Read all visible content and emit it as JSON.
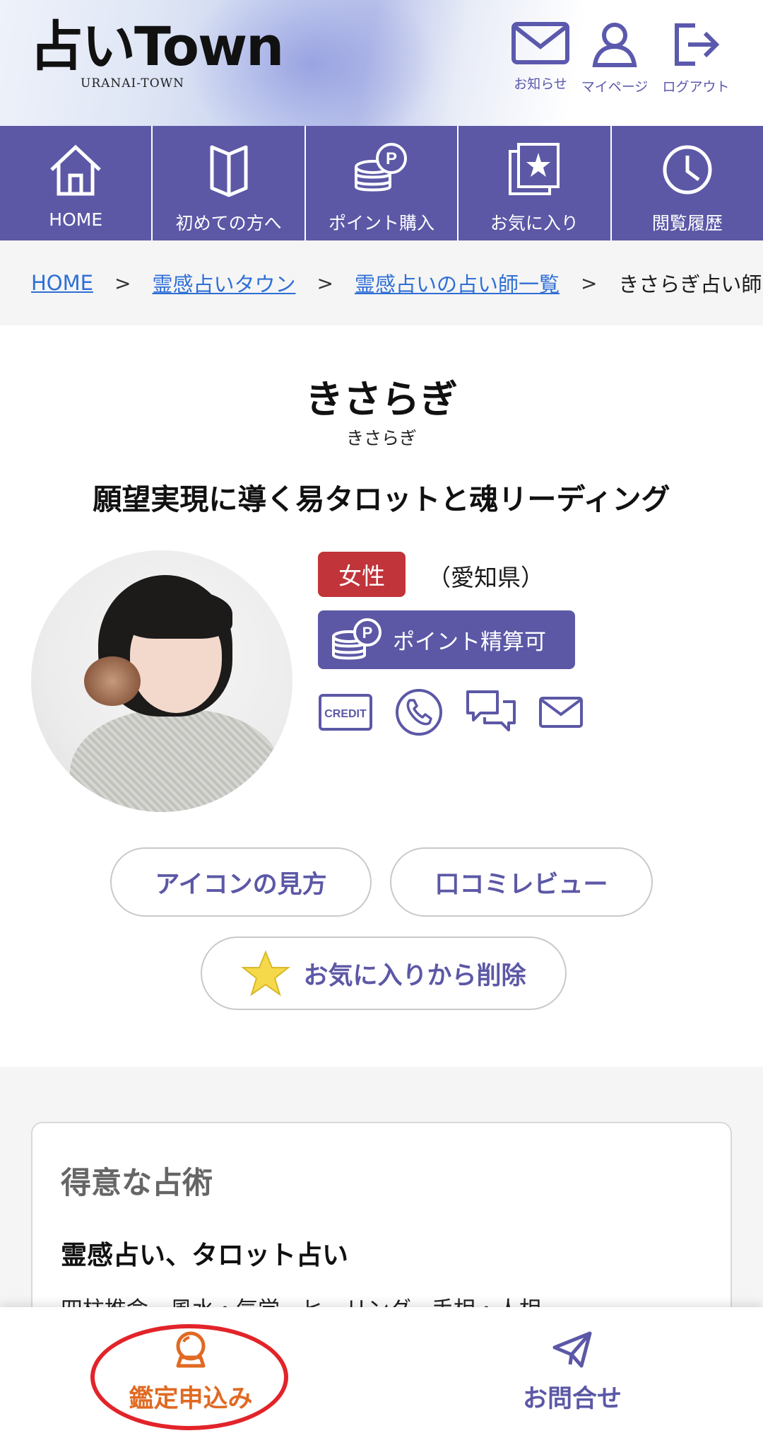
{
  "header": {
    "logo": "占いTown",
    "logo_sub": "URANAI-TOWN",
    "buttons": [
      {
        "label": "お知らせ",
        "icon": "mail-icon"
      },
      {
        "label": "マイページ",
        "icon": "user-icon"
      },
      {
        "label": "ログアウト",
        "icon": "logout-icon"
      }
    ]
  },
  "nav": {
    "items": [
      {
        "label": "HOME",
        "icon": "home-icon"
      },
      {
        "label": "初めての方へ",
        "icon": "book-icon"
      },
      {
        "label": "ポイント購入",
        "icon": "coins-point-icon"
      },
      {
        "label": "お気に入り",
        "icon": "favorite-star-icon"
      },
      {
        "label": "閲覧履歴",
        "icon": "clock-icon"
      }
    ]
  },
  "breadcrumb": {
    "items": [
      "HOME",
      "霊感占いタウン",
      "霊感占いの占い師一覧"
    ],
    "current": "きさらぎ占い師の"
  },
  "profile": {
    "name": "きさらぎ",
    "kana": "きさらぎ",
    "catchphrase": "願望実現に導く易タロットと魂リーディング",
    "gender": "女性",
    "prefecture": "（愛知県）",
    "point_badge": "ポイント精算可",
    "payment_icons": [
      "credit-icon",
      "phone-icon",
      "chat-icon",
      "mail-icon"
    ],
    "credit_text": "CREDIT"
  },
  "actions": {
    "icon_guide": "アイコンの見方",
    "reviews": "口コミレビュー",
    "favorite_remove": "お気に入りから削除"
  },
  "skills": {
    "heading": "得意な占術",
    "main": "霊感占い、タロット占い",
    "sub": "四柱推命、風水・気学、ヒーリング、手相・人相"
  },
  "bottom_bar": {
    "apply": "鑑定申込み",
    "contact": "お問合せ"
  },
  "colors": {
    "primary": "#5c58a6",
    "female_tag": "#c0343a",
    "apply_orange": "#e06a23",
    "link_blue": "#2f6fd6",
    "annotation_red": "#e2242a"
  }
}
